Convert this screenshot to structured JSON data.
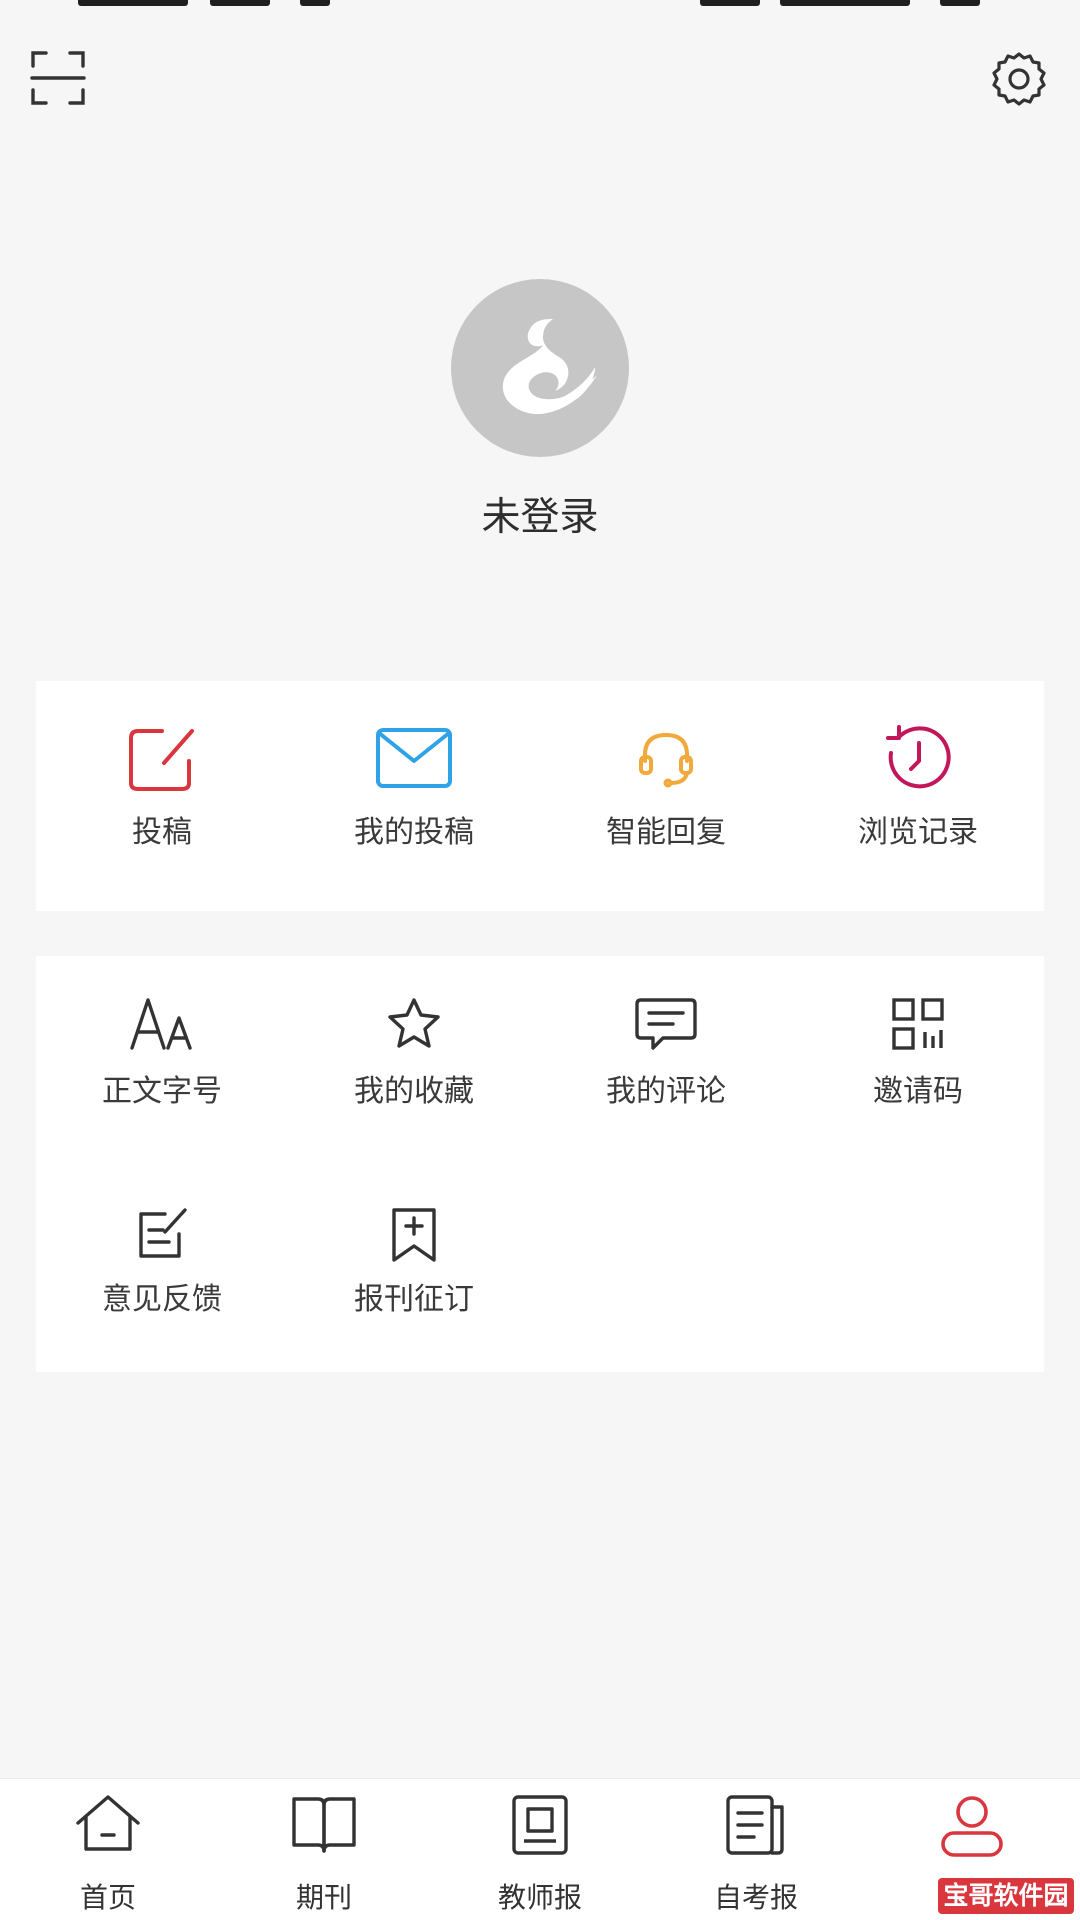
{
  "profile": {
    "login_status": "未登录"
  },
  "quick_actions": [
    {
      "label": "投稿",
      "icon": "edit-square-icon",
      "color": "#d9363e"
    },
    {
      "label": "我的投稿",
      "icon": "envelope-icon",
      "color": "#2fa3e6"
    },
    {
      "label": "智能回复",
      "icon": "headset-icon",
      "color": "#f0a93a"
    },
    {
      "label": "浏览记录",
      "icon": "history-clock-icon",
      "color": "#c2185b"
    }
  ],
  "tools": [
    {
      "label": "正文字号",
      "icon": "font-size-icon"
    },
    {
      "label": "我的收藏",
      "icon": "star-icon"
    },
    {
      "label": "我的评论",
      "icon": "comment-icon"
    },
    {
      "label": "邀请码",
      "icon": "qr-code-icon"
    },
    {
      "label": "意见反馈",
      "icon": "feedback-icon"
    },
    {
      "label": "报刊征订",
      "icon": "bookmark-add-icon"
    }
  ],
  "tabs": [
    {
      "label": "首页",
      "icon": "home-icon"
    },
    {
      "label": "期刊",
      "icon": "book-icon"
    },
    {
      "label": "教师报",
      "icon": "newspaper-icon"
    },
    {
      "label": "自考报",
      "icon": "document-icon"
    },
    {
      "label": "",
      "icon": "user-icon",
      "active": true
    }
  ],
  "watermark": "宝哥软件园",
  "colors": {
    "accent": "#d9363e",
    "background": "#f6f6f6",
    "card": "#ffffff",
    "text": "#333333"
  }
}
